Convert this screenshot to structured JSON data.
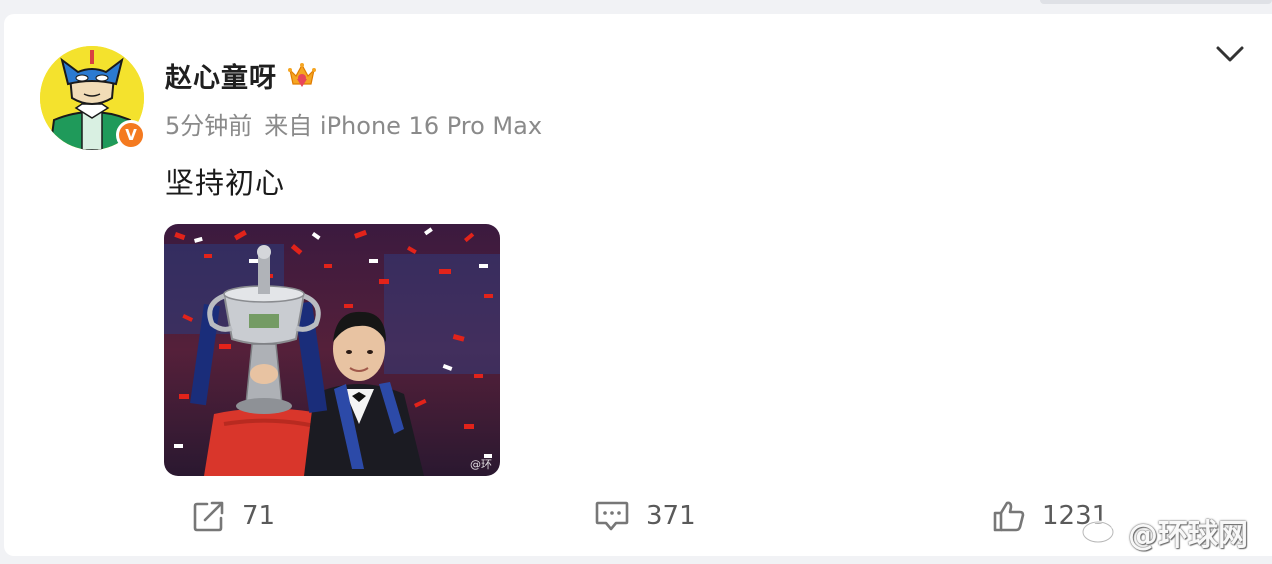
{
  "post": {
    "username": "赵心童呀",
    "time": "5分钟前",
    "source": "来自 iPhone 16 Pro Max",
    "text": "坚持初心",
    "verified_badge": "V",
    "photo_mark": "@环"
  },
  "actions": {
    "repost_count": "71",
    "comment_count": "371",
    "like_count": "1231"
  },
  "watermark": {
    "text": "@环球网"
  },
  "icons": {
    "crown": "crown-badge-icon",
    "chevron": "chevron-down-icon",
    "repost": "share-arrow-icon",
    "comment": "comment-bubble-icon",
    "like": "thumbs-up-icon"
  },
  "colors": {
    "verified": "#f47a20",
    "text_primary": "#1f1f1f",
    "text_secondary": "#8a8a8a",
    "background": "#f1f2f5"
  }
}
